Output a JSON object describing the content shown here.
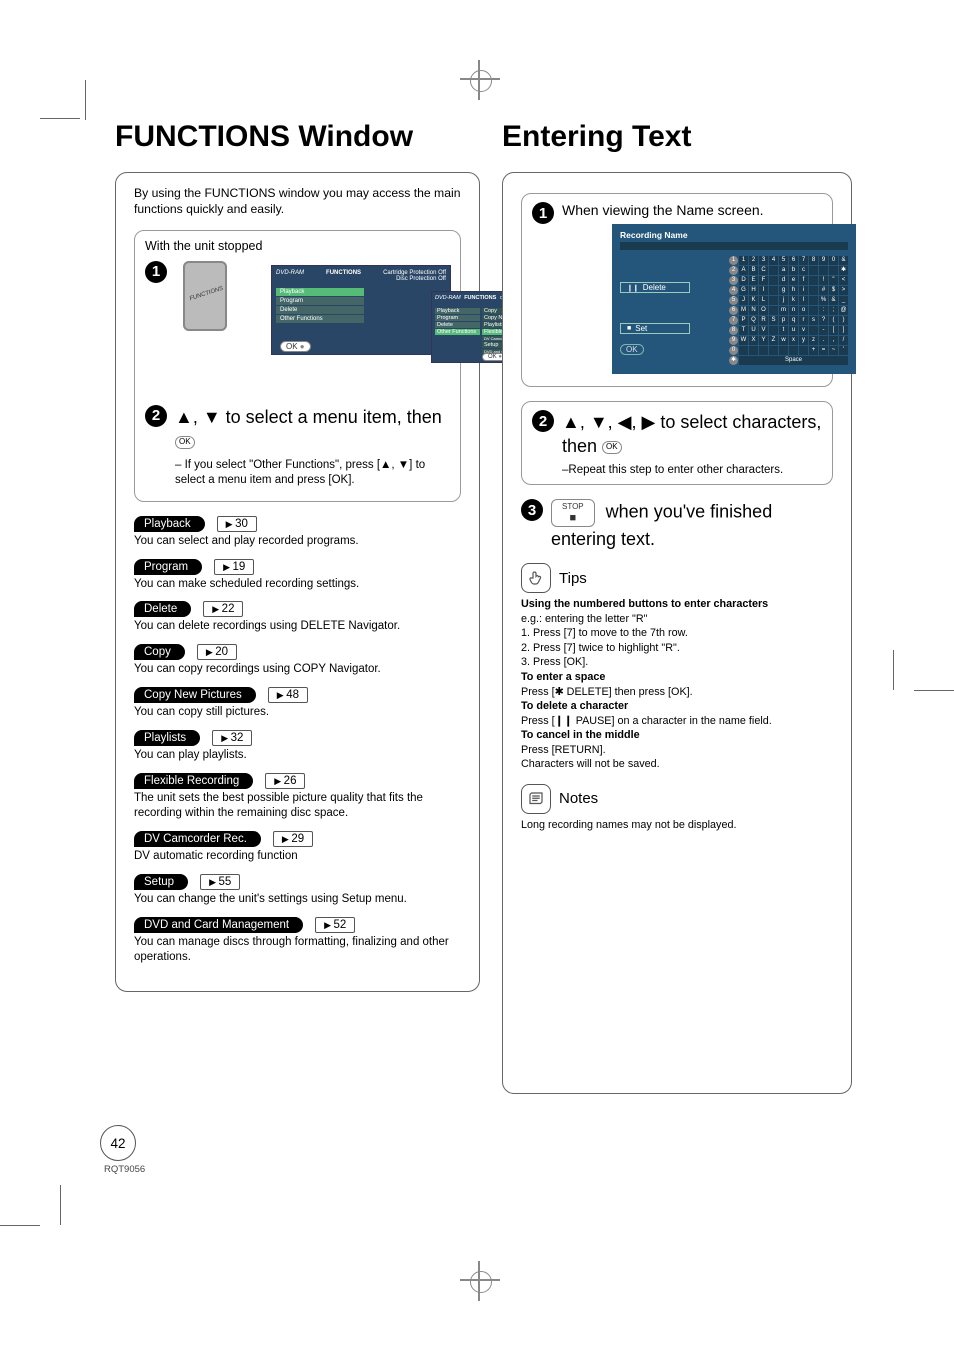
{
  "left": {
    "title": "FUNCTIONS Window",
    "intro": "By using the FUNCTIONS window you may access the main functions quickly and easily.",
    "unit_stopped": "With the unit stopped",
    "screen": {
      "label_functions": "FUNCTIONS",
      "label_dvd_ram": "DVD-RAM",
      "label_cart_off": "Cartridge Protection Off",
      "label_disc_off": "Disc Protection Off",
      "label_playback": "Playback",
      "label_program": "Program",
      "label_delete": "Delete",
      "label_other": "Other Functions",
      "label_copy": "Copy",
      "label_copy_new": "Copy New Pictures",
      "label_playlists": "Playlists",
      "label_flex": "Flexible Recording",
      "label_setup": "Setup",
      "label_dvd_card": "DVD and Card Management",
      "nav_ok": "OK"
    },
    "step2": {
      "text": "▲, ▼ to select a menu item, then ",
      "ok": "OK",
      "note": "– If you select \"Other Functions\", press [▲, ▼] to select a menu item and press [OK]."
    },
    "items": [
      {
        "label": "Playback",
        "ref": "30",
        "desc": "You can select and play recorded programs."
      },
      {
        "label": "Program",
        "ref": "19",
        "desc": "You can make scheduled recording settings."
      },
      {
        "label": "Delete",
        "ref": "22",
        "desc": "You can delete recordings using DELETE Navigator."
      },
      {
        "label": "Copy",
        "ref": "20",
        "desc": "You can copy recordings using COPY Navigator."
      },
      {
        "label": "Copy New Pictures",
        "ref": "48",
        "desc": "You can copy still pictures."
      },
      {
        "label": "Playlists",
        "ref": "32",
        "desc": "You can play playlists."
      },
      {
        "label": "Flexible Recording",
        "ref": "26",
        "desc": "The unit sets the best possible picture quality that fits the recording within the remaining disc space."
      },
      {
        "label": "DV Camcorder Rec.",
        "ref": "29",
        "desc": "DV automatic recording function"
      },
      {
        "label": "Setup",
        "ref": "55",
        "desc": "You can change the unit's settings using Setup menu."
      },
      {
        "label": "DVD and Card Management",
        "ref": "52",
        "desc": "You can manage discs through formatting, finalizing and other operations."
      }
    ]
  },
  "right": {
    "title": "Entering Text",
    "step1": {
      "text": "When viewing the Name screen.",
      "screen_title": "Recording Name",
      "delete": "Delete",
      "set": "Set",
      "space": "Space",
      "ok": "OK"
    },
    "step2": {
      "text1": "▲, ▼, ◀, ▶ to select characters, then ",
      "ok": "OK",
      "note": "–Repeat this step to enter other characters."
    },
    "step3": {
      "stop": "STOP",
      "text": " when you've finished entering text."
    },
    "tips": {
      "heading": "Tips",
      "l1": "Using the numbered buttons to enter characters",
      "l2": "e.g.: entering the letter \"R\"",
      "l3": "1.  Press [7] to move to the 7th row.",
      "l4": "2.  Press [7] twice to highlight \"R\".",
      "l5": "3.  Press [OK].",
      "l6": "To enter a space",
      "l7": "Press [✱ DELETE] then press [OK].",
      "l8": "To delete a character",
      "l9": "Press [❙❙ PAUSE] on a character in the name field.",
      "l10": "To cancel in the middle",
      "l11": "Press [RETURN].",
      "l12": "Characters will not be saved."
    },
    "notes": {
      "heading": "Notes",
      "l1": "Long recording names may not be displayed."
    }
  },
  "page_num": "42",
  "rqt": "RQT9056"
}
